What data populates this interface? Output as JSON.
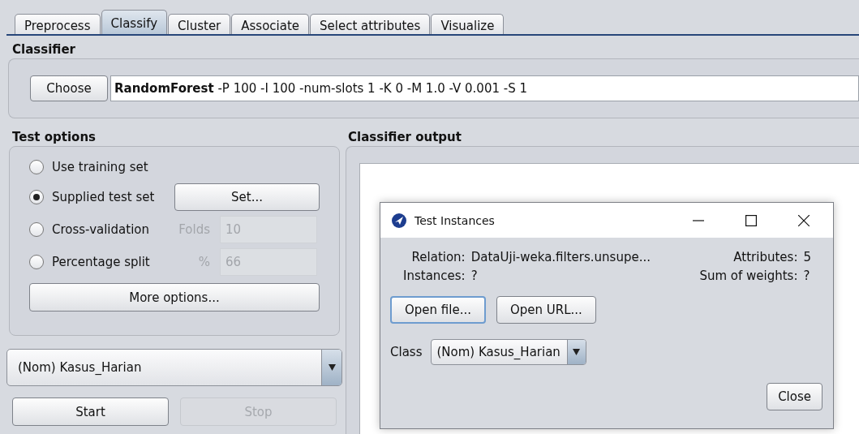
{
  "tabs": [
    {
      "label": "Preprocess",
      "selected": false
    },
    {
      "label": "Classify",
      "selected": true
    },
    {
      "label": "Cluster",
      "selected": false
    },
    {
      "label": "Associate",
      "selected": false
    },
    {
      "label": "Select attributes",
      "selected": false
    },
    {
      "label": "Visualize",
      "selected": false
    }
  ],
  "classifier": {
    "title": "Classifier",
    "button": "Choose",
    "value": "**RandomForest** -P 100 -I 100 -num-slots 1 -K 0 -M 1.0 -V 0.001 -S 1"
  },
  "test_options": {
    "title": "Test options",
    "options": [
      {
        "label": "Use training set",
        "selected": false
      },
      {
        "label": "Supplied test set",
        "selected": true,
        "extra": {
          "kind": "button",
          "label": "Set...",
          "disabled": false
        }
      },
      {
        "label": "Cross-validation",
        "selected": false,
        "extra": {
          "kind": "field",
          "label": "Folds",
          "value": "10",
          "disabled": true
        }
      },
      {
        "label": "Percentage split",
        "selected": false,
        "extra": {
          "kind": "field",
          "label": "%",
          "value": "66",
          "disabled": true
        }
      }
    ],
    "more_button": "More options..."
  },
  "class_select": {
    "value": "(Nom) Kasus_Harian"
  },
  "actions": [
    {
      "label": "Start",
      "disabled": false
    },
    {
      "label": "Stop",
      "disabled": true
    }
  ],
  "output": {
    "title": "Classifier output"
  },
  "dialog": {
    "title": "Test Instances",
    "info_left": [
      {
        "label": "Relation:",
        "value": "DataUji-weka.filters.unsupe..."
      },
      {
        "label": "Instances:",
        "value": "?"
      }
    ],
    "info_right": [
      {
        "label": "Attributes:",
        "value": "5"
      },
      {
        "label": "Sum of weights:",
        "value": "?"
      }
    ],
    "buttons": [
      {
        "label": "Open file...",
        "focused": true
      },
      {
        "label": "Open URL...",
        "focused": false
      }
    ],
    "class_label": "Class",
    "class_value": "(Nom) Kasus_Harian",
    "close": "Close"
  }
}
